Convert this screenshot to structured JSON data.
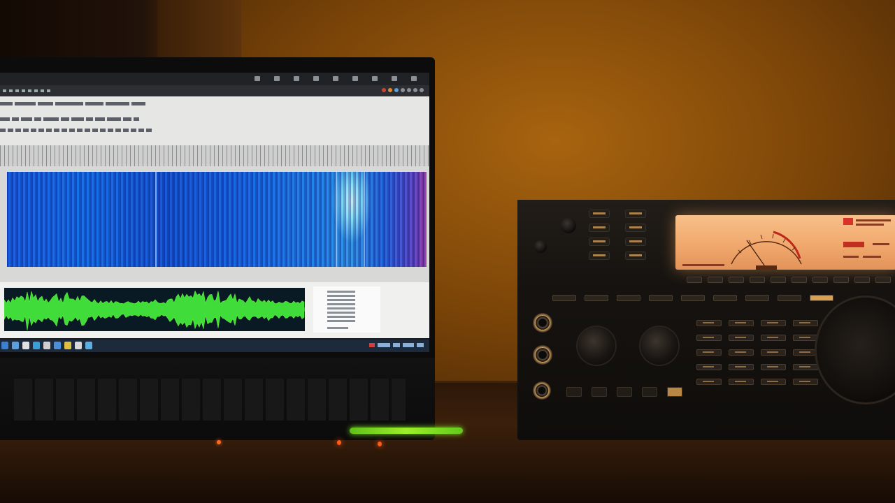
{
  "scene": {
    "description_labels": {
      "laptop": "laptop",
      "radio": "radio"
    }
  },
  "colors": {
    "wall": "#7a4408",
    "spectrogram": "#1f66e0",
    "waveform": "#3fdc3a",
    "radio_display": "#f0a66a",
    "cable": "#9bef2a"
  },
  "icons": [
    "window-control-icon",
    "app-icon",
    "led-indicator-icon"
  ]
}
